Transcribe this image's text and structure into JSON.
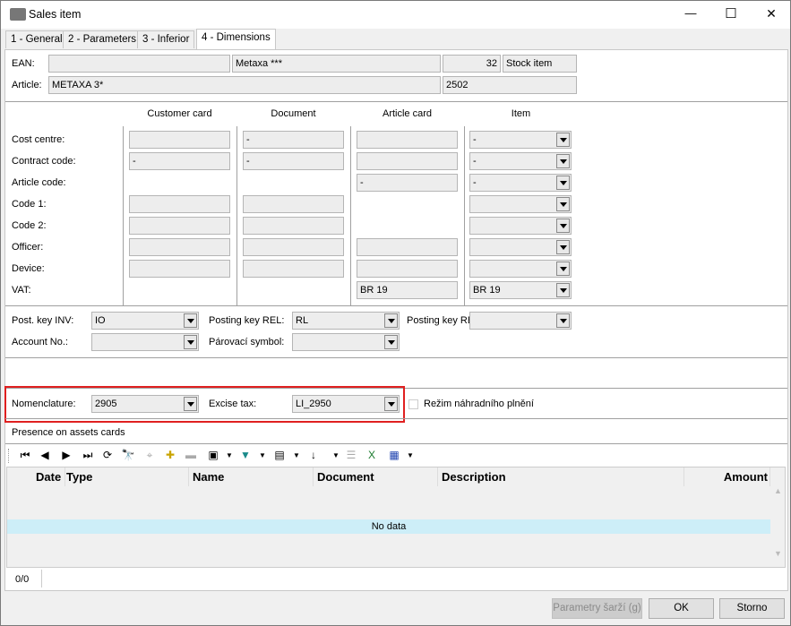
{
  "window": {
    "title": "Sales item",
    "minimize": "—",
    "maximize": "☐",
    "close": "✕"
  },
  "tabs": [
    {
      "label": "1 - General"
    },
    {
      "label": "2 - Parameters"
    },
    {
      "label": "3 - Inferior"
    },
    {
      "label": "4 - Dimensions",
      "active": true
    }
  ],
  "header": {
    "ean_label": "EAN:",
    "ean": "",
    "name": "Metaxa ***",
    "number": "32",
    "stock": "Stock item",
    "article_label": "Article:",
    "article": "METAXA 3*",
    "code": "2502"
  },
  "grid": {
    "columns": [
      "Customer card",
      "Document",
      "Article card",
      "Item"
    ],
    "rows": [
      {
        "label": "Cost centre:",
        "cells": [
          "",
          "-",
          "",
          "-"
        ]
      },
      {
        "label": "Contract code:",
        "cells": [
          "-",
          "-",
          "",
          "-"
        ]
      },
      {
        "label": "Article code:",
        "cells": [
          null,
          null,
          "-",
          "-"
        ]
      },
      {
        "label": "Code 1:",
        "cells": [
          "",
          "",
          null,
          ""
        ]
      },
      {
        "label": "Code 2:",
        "cells": [
          "",
          "",
          null,
          ""
        ]
      },
      {
        "label": "Officer:",
        "cells": [
          "",
          "",
          "",
          ""
        ]
      },
      {
        "label": "Device:",
        "cells": [
          "",
          "",
          "",
          ""
        ]
      },
      {
        "label": "VAT:",
        "cells": [
          null,
          null,
          "BR 19",
          "BR 19"
        ]
      }
    ]
  },
  "posting": {
    "inv_label": "Post. key INV:",
    "inv": "IO",
    "rel_label": "Posting key REL:",
    "rel": "RL",
    "re_label": "Posting key RE",
    "re": "",
    "account_label": "Account No.:",
    "account": "",
    "parovaci_label": "Párovací symbol:",
    "parovaci": ""
  },
  "nomenclature": {
    "label": "Nomenclature:",
    "value": "2905",
    "excise_label": "Excise tax:",
    "excise": "LI_2950",
    "checkbox_label": "Režim náhradního plnění",
    "checked": false,
    "highlight_color": "#e02020"
  },
  "assets": {
    "title": "Presence on assets cards",
    "columns": [
      "Date",
      "Type",
      "Name",
      "Document",
      "Description",
      "Amount"
    ],
    "empty": "No data",
    "status": "0/0"
  },
  "toolbar": {
    "icons": [
      "first-icon",
      "prev-icon",
      "next-icon",
      "last-icon",
      "refresh-icon",
      "find-icon",
      "find-disabled-icon",
      "add-filter-icon",
      "remove-filter-icon",
      "snapshot-icon",
      "filter-icon",
      "columns-icon",
      "sort-icon",
      "list-icon",
      "excel-icon",
      "report-icon"
    ]
  },
  "buttons": {
    "parametry": "Parametry šarží (g)",
    "ok": "OK",
    "storno": "Storno"
  }
}
